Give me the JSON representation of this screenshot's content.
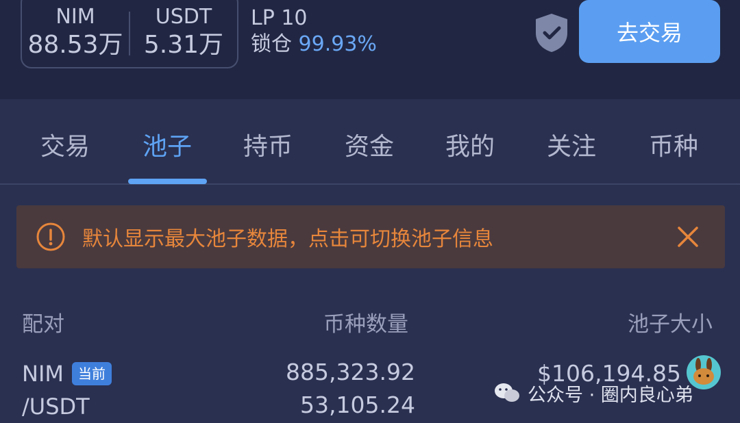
{
  "header": {
    "stats": [
      {
        "label": "NIM",
        "value": "88.53万"
      },
      {
        "label": "USDT",
        "value": "5.31万"
      }
    ],
    "lp_text": "LP 10",
    "lock_label": "锁仓",
    "lock_percent": "99.93%",
    "trade_button": "去交易"
  },
  "tabs": [
    {
      "label": "交易",
      "active": false
    },
    {
      "label": "池子",
      "active": true
    },
    {
      "label": "持币",
      "active": false
    },
    {
      "label": "资金",
      "active": false
    },
    {
      "label": "我的",
      "active": false
    },
    {
      "label": "关注",
      "active": false
    },
    {
      "label": "币种",
      "active": false
    }
  ],
  "notice": {
    "text": "默认显示最大池子数据，点击可切换池子信息"
  },
  "table": {
    "headers": [
      "配对",
      "币种数量",
      "池子大小"
    ],
    "row": {
      "pair_top": "NIM",
      "badge": "当前",
      "pair_bottom": "/USDT",
      "amount_1": "885,323.92",
      "amount_2": "53,105.24",
      "pool_size": "$106,194.85"
    }
  },
  "watermark": {
    "text": "公众号 · 圈内良心弟"
  },
  "colors": {
    "accent": "#5b9ef1",
    "warning": "#e7863b",
    "background": "#2a3050"
  }
}
